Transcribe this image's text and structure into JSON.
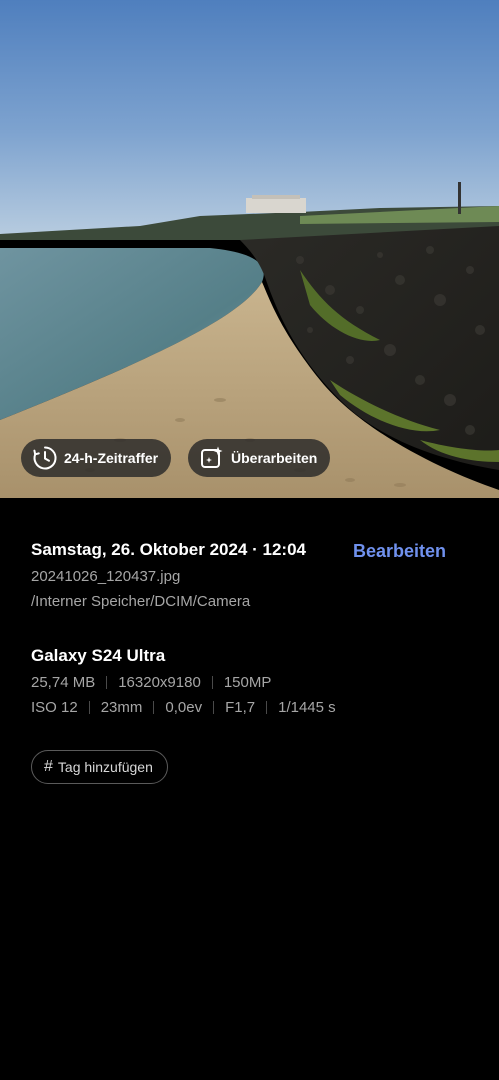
{
  "photo": {
    "actions": {
      "timelapse_label": "24-h-Zeitraffer",
      "remaster_label": "Überarbeiten"
    }
  },
  "details": {
    "date_time": "Samstag, 26. Oktober 2024 · 12:04",
    "edit_label": "Bearbeiten",
    "filename": "20241026_120437.jpg",
    "path": "/Interner Speicher/DCIM/Camera",
    "device": "Galaxy S24 Ultra",
    "file_specs": [
      "25,74 MB",
      "16320x9180",
      "150MP"
    ],
    "camera_specs": [
      "ISO 12",
      "23mm",
      "0,0ev",
      "F1,7",
      "1/1445 s"
    ],
    "tag_label": "Tag hinzufügen"
  },
  "colors": {
    "accent": "#7091ee",
    "background": "#000000",
    "secondary_text": "#a6a6a6"
  },
  "icons": {
    "timelapse": "clock-timelapse-icon",
    "remaster": "sparkle-edit-icon",
    "tag": "hash-icon"
  }
}
